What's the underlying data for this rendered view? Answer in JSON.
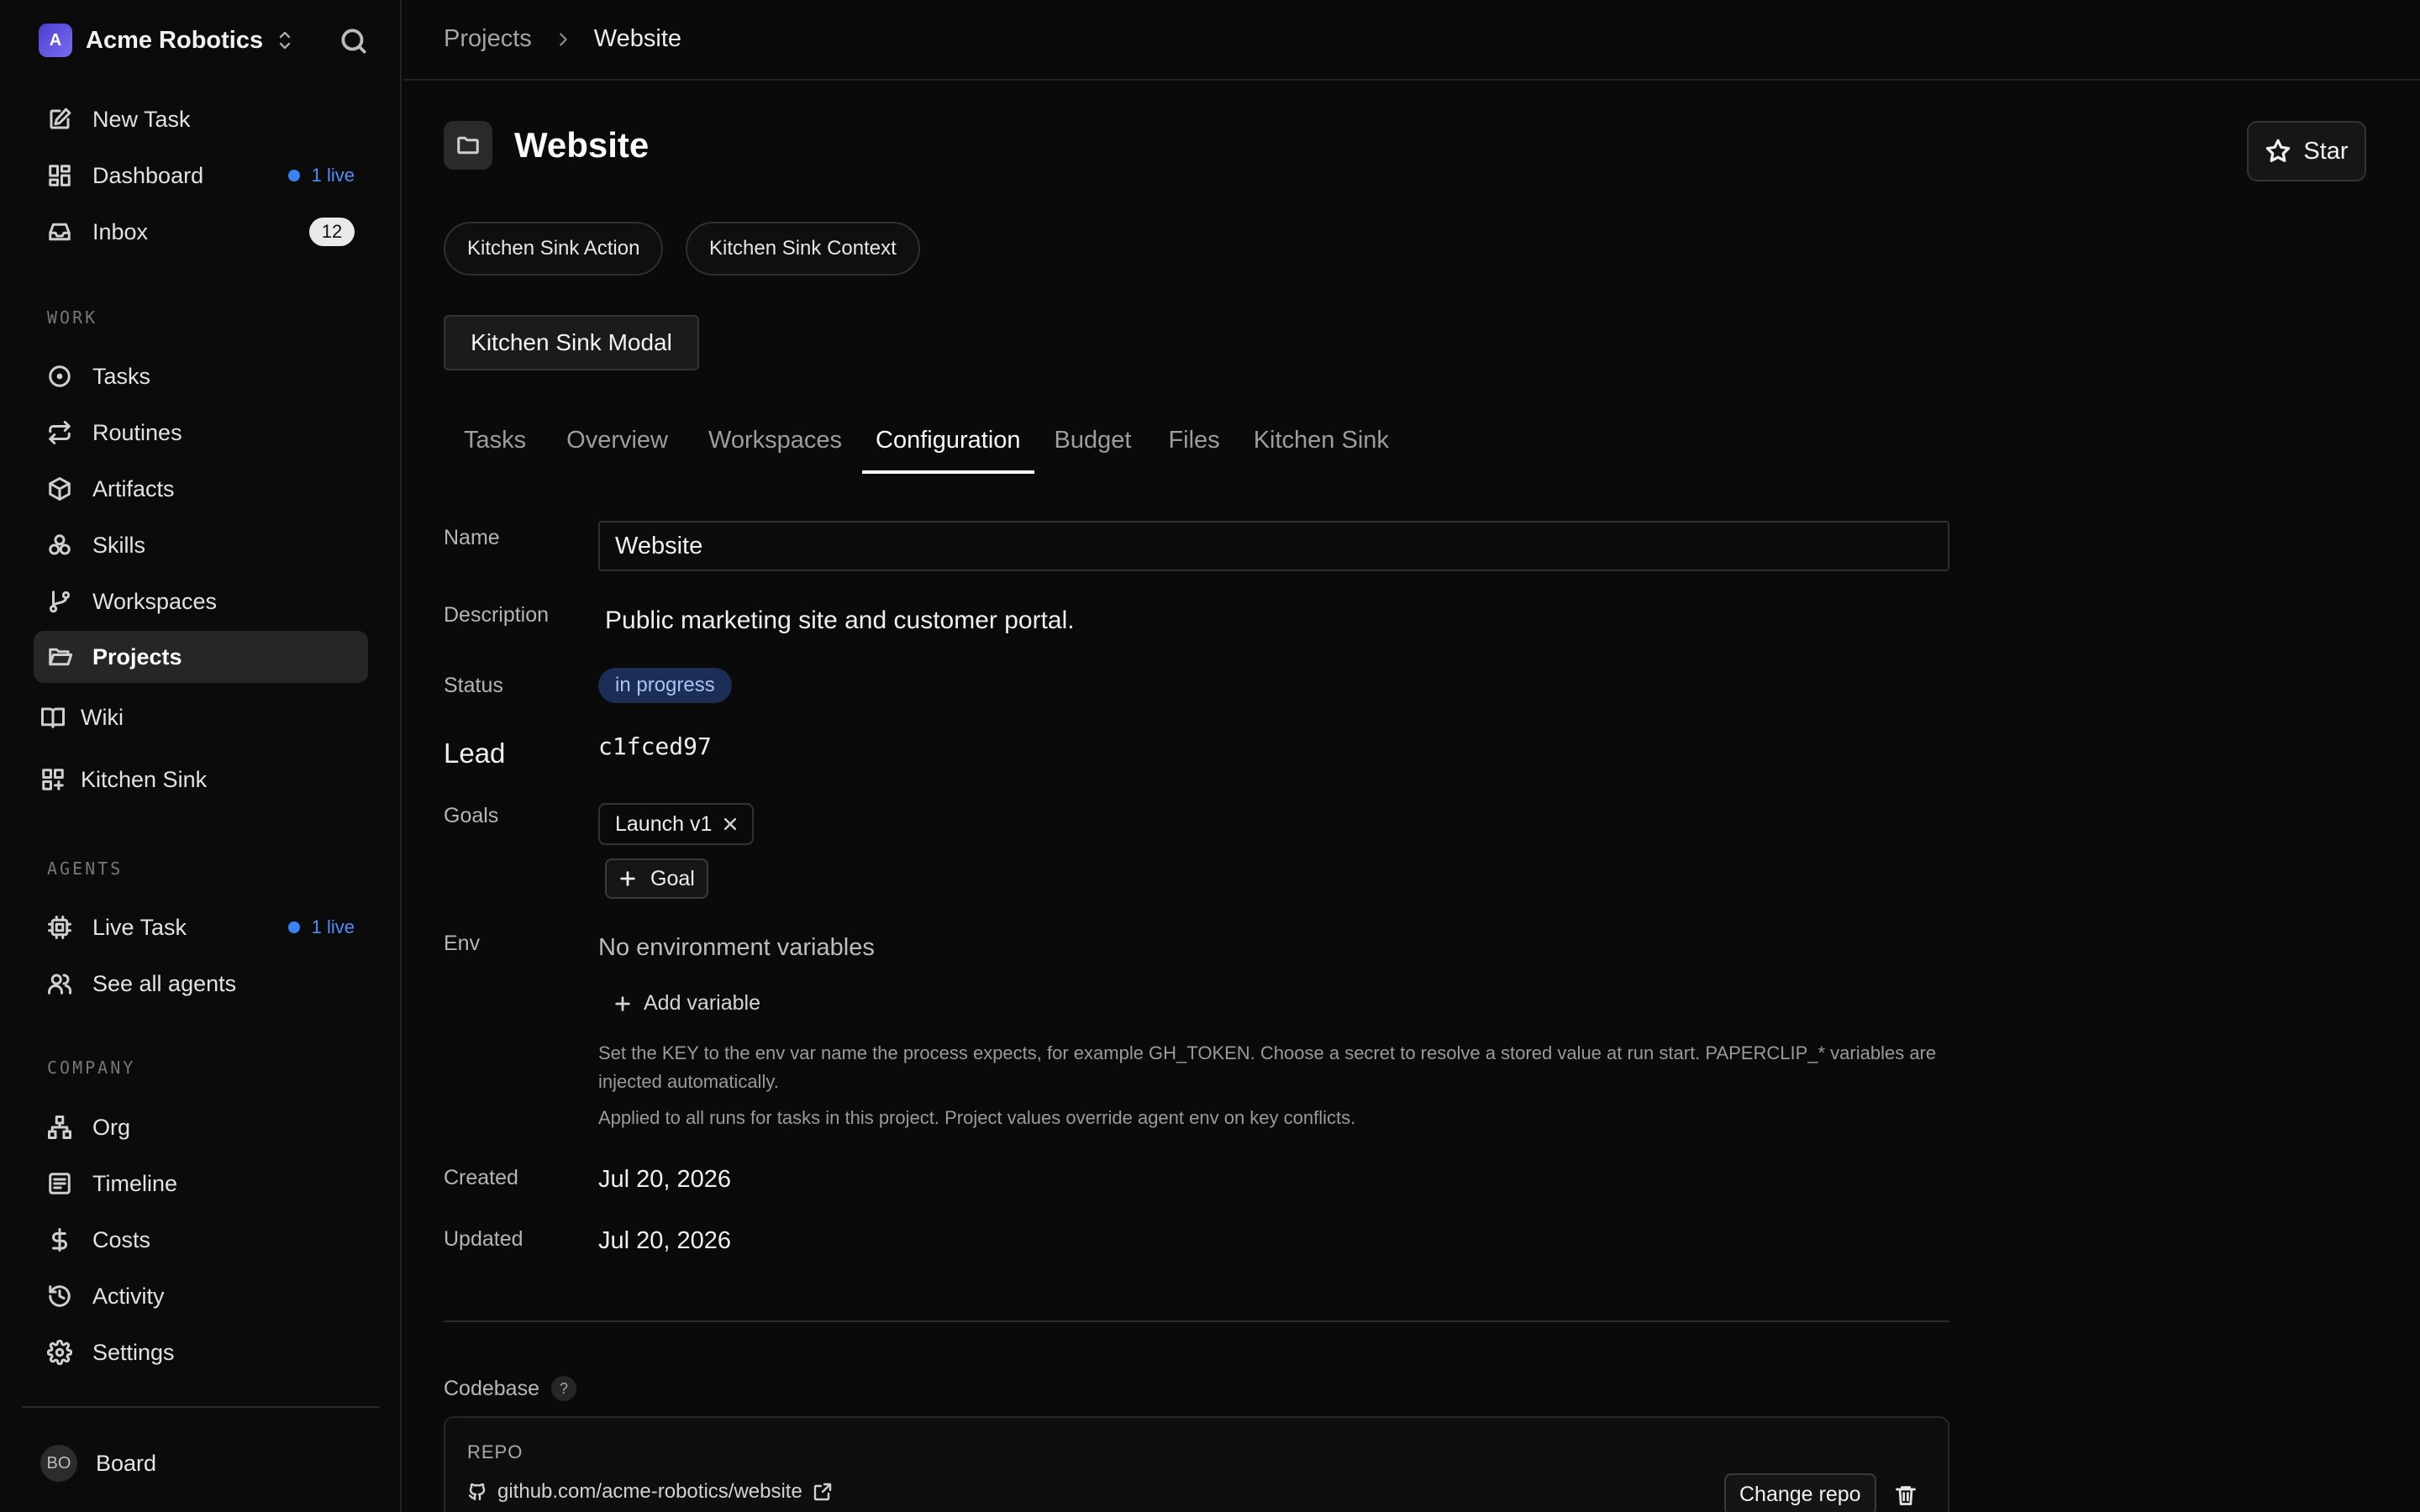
{
  "sidebar": {
    "company_name": "Acme Robotics",
    "logo_letter": "A",
    "brand_color": "#5b4ee0",
    "top_items": [
      {
        "label": "New Task",
        "icon": "pencil-square-icon"
      },
      {
        "label": "Dashboard",
        "icon": "dashboard-icon",
        "live": "1 live"
      },
      {
        "label": "Inbox",
        "icon": "inbox-icon",
        "count": "12"
      }
    ],
    "work_label": "WORK",
    "work_items": [
      {
        "label": "Tasks",
        "icon": "circle-dot-icon"
      },
      {
        "label": "Routines",
        "icon": "repeat-icon"
      },
      {
        "label": "Artifacts",
        "icon": "box-icon"
      },
      {
        "label": "Skills",
        "icon": "skills-icon"
      },
      {
        "label": "Workspaces",
        "icon": "git-branch-icon"
      },
      {
        "label": "Projects",
        "icon": "folder-open-icon",
        "active": true
      },
      {
        "label": "Wiki",
        "icon": "book-icon"
      },
      {
        "label": "Kitchen Sink",
        "icon": "grid-plus-icon"
      }
    ],
    "agents_label": "AGENTS",
    "agent_items": [
      {
        "label": "Live Task",
        "icon": "cpu-icon",
        "live": "1 live"
      },
      {
        "label": "See all agents",
        "icon": "users-icon"
      }
    ],
    "company_label": "COMPANY",
    "company_items": [
      {
        "label": "Org",
        "icon": "org-chart-icon"
      },
      {
        "label": "Timeline",
        "icon": "timeline-icon"
      },
      {
        "label": "Costs",
        "icon": "dollar-icon"
      },
      {
        "label": "Activity",
        "icon": "history-icon"
      },
      {
        "label": "Settings",
        "icon": "gear-icon"
      }
    ],
    "user": {
      "initials": "BO",
      "name": "Board"
    },
    "live_color": "#3b82f6"
  },
  "breadcrumb": {
    "parent": "Projects",
    "current": "Website"
  },
  "header": {
    "title": "Website",
    "star_label": "Star"
  },
  "actions": {
    "action_label": "Kitchen Sink Action",
    "context_label": "Kitchen Sink Context",
    "modal_label": "Kitchen Sink Modal"
  },
  "tabs": [
    "Tasks",
    "Overview",
    "Workspaces",
    "Configuration",
    "Budget",
    "Files",
    "Kitchen Sink"
  ],
  "active_tab": "Configuration",
  "config": {
    "name_label": "Name",
    "name_value": "Website",
    "description_label": "Description",
    "description_value": "Public marketing site and customer portal.",
    "status_label": "Status",
    "status_value": "in progress",
    "status_color": "#1c2e55",
    "lead_label": "Lead",
    "lead_value": "c1fced97",
    "goals_label": "Goals",
    "goal_chip": "Launch v1",
    "add_goal_label": "Goal",
    "env_label": "Env",
    "env_empty": "No environment variables",
    "add_variable_label": "Add variable",
    "env_help": "Set the KEY to the env var name the process expects, for example GH_TOKEN. Choose a secret to resolve a stored value at run start. PAPERCLIP_* variables are injected automatically.",
    "env_help_2": "Applied to all runs for tasks in this project. Project values override agent env on key conflicts.",
    "created_label": "Created",
    "created_value": "Jul 20, 2026",
    "updated_label": "Updated",
    "updated_value": "Jul 20, 2026"
  },
  "codebase": {
    "label": "Codebase",
    "help": "?",
    "repo_title": "REPO",
    "repo_url": "github.com/acme-robotics/website",
    "change_repo_label": "Change repo"
  }
}
